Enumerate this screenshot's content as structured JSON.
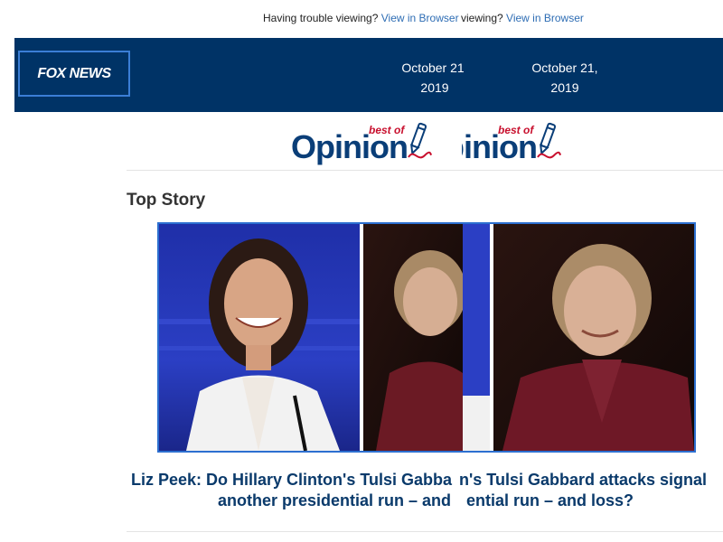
{
  "preheader": {
    "trouble_text": "Having trouble viewing?",
    "trouble_text_2": "viewing?",
    "link_label": "View in Browser",
    "link_label_2": "View in Browser"
  },
  "header": {
    "logo_text": "FOX NEWS",
    "date_line1": "October 21,",
    "date_line2": "2019"
  },
  "banner": {
    "word_full": "Opinion",
    "word_partial": "inion",
    "best_of": "best of"
  },
  "section": {
    "title": "Top Story"
  },
  "story": {
    "headline_left_line1": "Liz Peek: Do Hillary Clinton's Tulsi Gabba",
    "headline_left_line2": "another presidential run – and",
    "headline_right_line1": "n's Tulsi Gabbard attacks signal",
    "headline_right_line2": "ential run – and loss?"
  },
  "colors": {
    "header_bg": "#003366",
    "link": "#2e6db4",
    "headline": "#0a3a6b",
    "banner_blue": "#0a3e78",
    "banner_red": "#c8102e"
  }
}
